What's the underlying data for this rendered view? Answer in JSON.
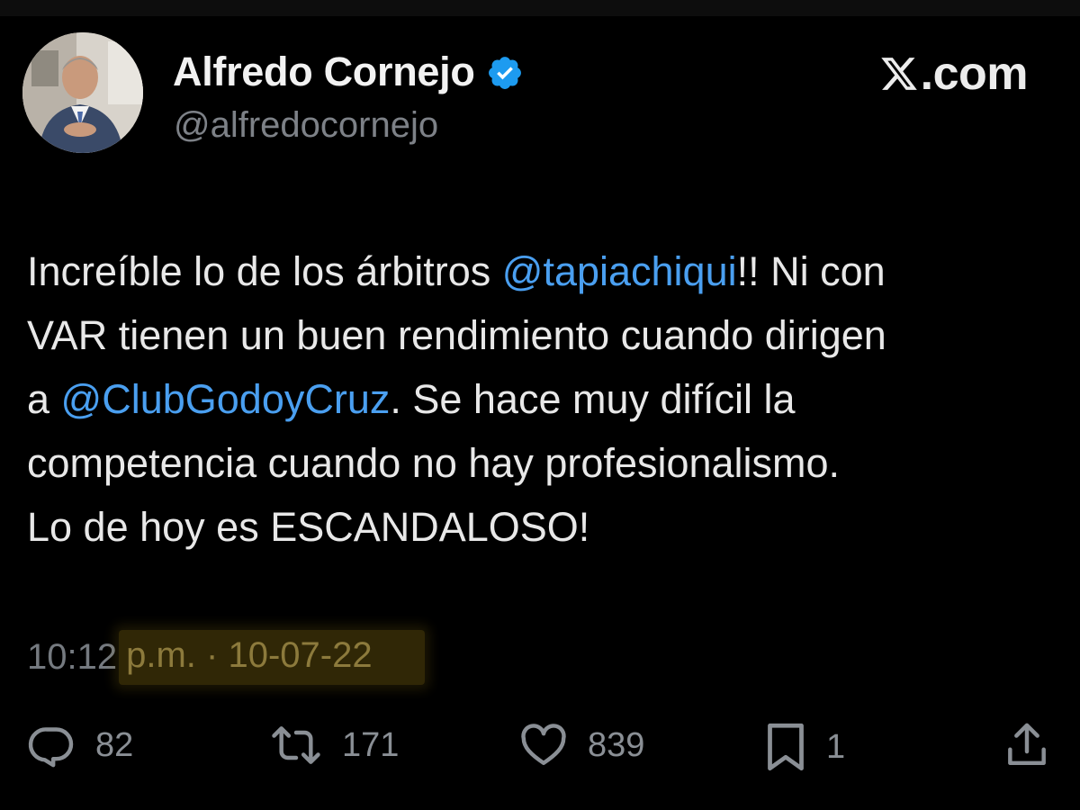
{
  "author": {
    "name": "Alfredo Cornejo",
    "handle": "@alfredocornejo",
    "verified": true
  },
  "site": {
    "logo_icon": "x-logo-icon",
    "domain_suffix": ".com"
  },
  "tweet": {
    "lines": [
      [
        {
          "text": "Increíble lo de los árbitros "
        },
        {
          "text": "@tapiachiqui",
          "mention": true
        },
        {
          "text": "!! Ni con"
        }
      ],
      [
        {
          "text": "VAR tienen un buen rendimiento cuando dirigen"
        }
      ],
      [
        {
          "text": "a "
        },
        {
          "text": "@ClubGodoyCruz",
          "mention": true
        },
        {
          "text": ". Se hace muy difícil la"
        }
      ],
      [
        {
          "text": "competencia cuando no hay profesionalismo."
        }
      ],
      [
        {
          "text": "Lo de hoy es ESCANDALOSO!"
        }
      ]
    ]
  },
  "timestamp": {
    "time": "10:12",
    "highlighted": "p.m. · 10-07-22"
  },
  "actions": {
    "reply_count": "82",
    "repost_count": "171",
    "like_count": "839",
    "bookmark_count": "1"
  },
  "colors": {
    "background": "#000000",
    "mention": "#4a9ff0",
    "verified_badge": "#1d9bf0",
    "muted_text": "#757a80",
    "highlight": "#8c7a3c"
  }
}
